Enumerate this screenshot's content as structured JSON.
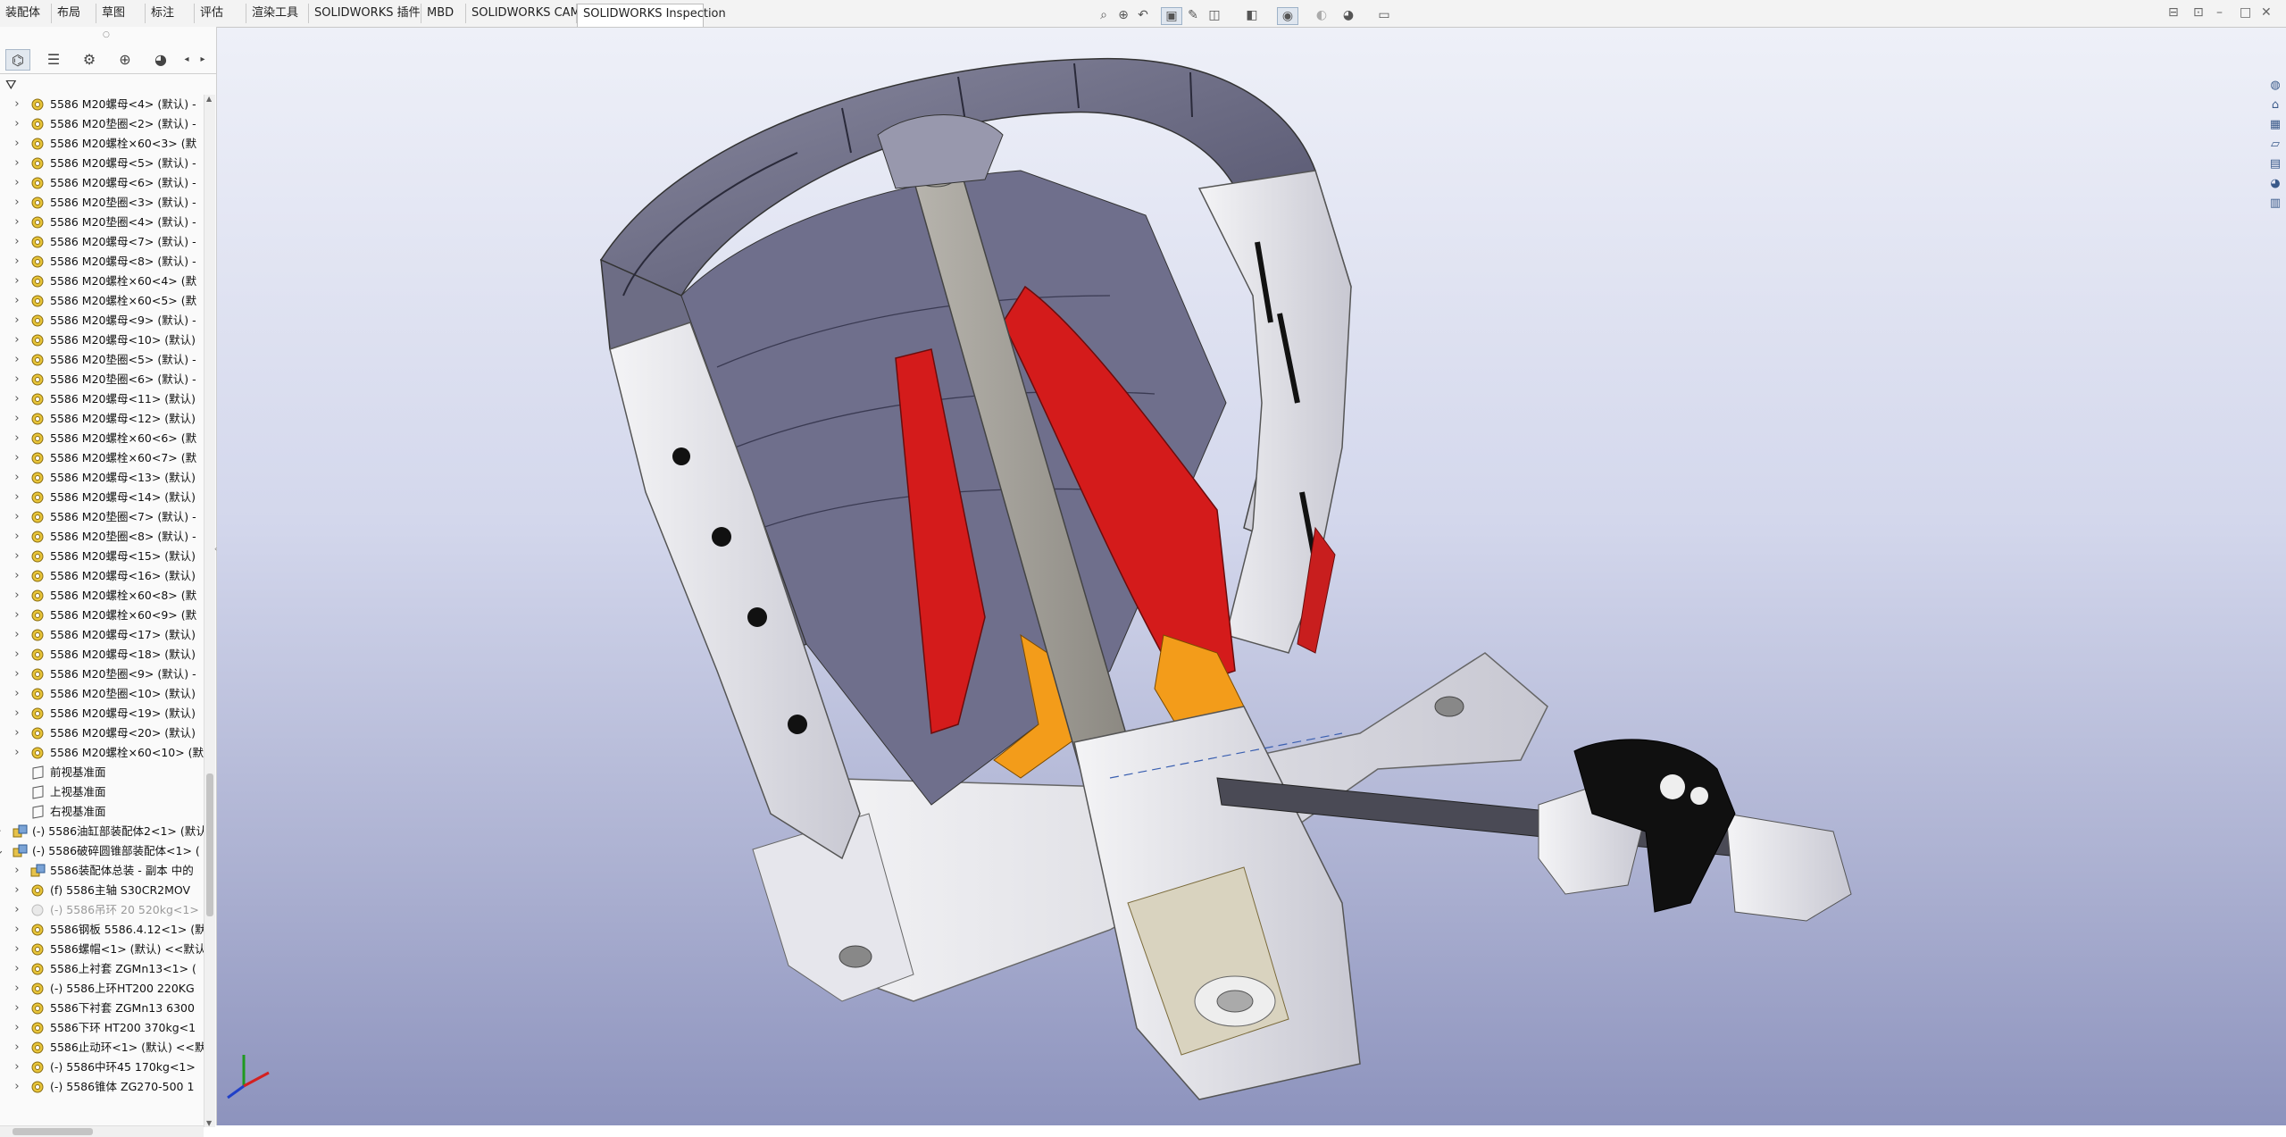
{
  "tabs": [
    {
      "label": "装配体"
    },
    {
      "label": "布局"
    },
    {
      "label": "草图"
    },
    {
      "label": "标注"
    },
    {
      "label": "评估"
    },
    {
      "label": "渲染工具"
    },
    {
      "label": "SOLIDWORKS 插件"
    },
    {
      "label": "MBD"
    },
    {
      "label": "SOLIDWORKS CAM"
    },
    {
      "label": "SOLIDWORKS Inspection",
      "active": true
    }
  ],
  "heads_up_icons": [
    "zoom-fit-icon",
    "zoom-area-icon",
    "previous-view-icon",
    "section-view-icon",
    "dynamic-annotation-icon",
    "view-orientation-icon",
    "display-style-icon",
    "hide-show-icon",
    "edit-appearance-icon",
    "apply-scene-icon",
    "view-settings-icon"
  ],
  "panel_tabs": [
    "feature-manager-icon",
    "property-manager-icon",
    "configuration-manager-icon",
    "dimxpert-manager-icon",
    "display-manager-icon"
  ],
  "tree": [
    {
      "label": "5586 M20螺母<4> (默认) -"
    },
    {
      "label": "5586 M20垫圈<2> (默认) -"
    },
    {
      "label": "5586 M20螺栓×60<3> (默"
    },
    {
      "label": "5586 M20螺母<5> (默认) -"
    },
    {
      "label": "5586 M20螺母<6> (默认) -"
    },
    {
      "label": "5586 M20垫圈<3> (默认) -"
    },
    {
      "label": "5586 M20垫圈<4> (默认) -"
    },
    {
      "label": "5586 M20螺母<7> (默认) -"
    },
    {
      "label": "5586 M20螺母<8> (默认) -"
    },
    {
      "label": "5586 M20螺栓×60<4> (默"
    },
    {
      "label": "5586 M20螺栓×60<5> (默"
    },
    {
      "label": "5586 M20螺母<9> (默认) -"
    },
    {
      "label": "5586 M20螺母<10> (默认)"
    },
    {
      "label": "5586 M20垫圈<5> (默认) -"
    },
    {
      "label": "5586 M20垫圈<6> (默认) -"
    },
    {
      "label": "5586 M20螺母<11> (默认)"
    },
    {
      "label": "5586 M20螺母<12> (默认)"
    },
    {
      "label": "5586 M20螺栓×60<6> (默"
    },
    {
      "label": "5586 M20螺栓×60<7> (默"
    },
    {
      "label": "5586 M20螺母<13> (默认)"
    },
    {
      "label": "5586 M20螺母<14> (默认)"
    },
    {
      "label": "5586 M20垫圈<7> (默认) -"
    },
    {
      "label": "5586 M20垫圈<8> (默认) -"
    },
    {
      "label": "5586 M20螺母<15> (默认)"
    },
    {
      "label": "5586 M20螺母<16> (默认)"
    },
    {
      "label": "5586 M20螺栓×60<8> (默"
    },
    {
      "label": "5586 M20螺栓×60<9> (默"
    },
    {
      "label": "5586 M20螺母<17> (默认)"
    },
    {
      "label": "5586 M20螺母<18> (默认)"
    },
    {
      "label": "5586 M20垫圈<9> (默认) -"
    },
    {
      "label": "5586 M20垫圈<10> (默认)"
    },
    {
      "label": "5586 M20螺母<19> (默认)"
    },
    {
      "label": "5586 M20螺母<20> (默认)"
    },
    {
      "label": "5586 M20螺栓×60<10> (默"
    },
    {
      "label": "前视基准面",
      "kind": "plane"
    },
    {
      "label": "上视基准面",
      "kind": "plane"
    },
    {
      "label": "右视基准面",
      "kind": "plane"
    },
    {
      "label": "(-) 5586油缸部装配体2<1> (默认",
      "kind": "asm"
    },
    {
      "label": "(-) 5586破碎圆锥部装配体<1> (",
      "kind": "asm",
      "expanded": true
    },
    {
      "label": "5586装配体总装 - 副本 中的",
      "kind": "ref"
    },
    {
      "label": "(f) 5586主轴 S30CR2MOV"
    },
    {
      "label": "(-) 5586吊环 20 520kg<1>",
      "kind": "hidden"
    },
    {
      "label": "5586钢板 5586.4.12<1> (默"
    },
    {
      "label": "5586螺帽<1> (默认) <<默认"
    },
    {
      "label": "5586上衬套 ZGMn13<1> ("
    },
    {
      "label": "(-) 5586上环HT200 220KG"
    },
    {
      "label": "5586下衬套 ZGMn13 6300"
    },
    {
      "label": "5586下环 HT200 370kg<1"
    },
    {
      "label": "5586止动环<1> (默认) <<默"
    },
    {
      "label": "(-) 5586中环45 170kg<1>"
    },
    {
      "label": "(-) 5586锥体 ZG270-500 1"
    }
  ]
}
